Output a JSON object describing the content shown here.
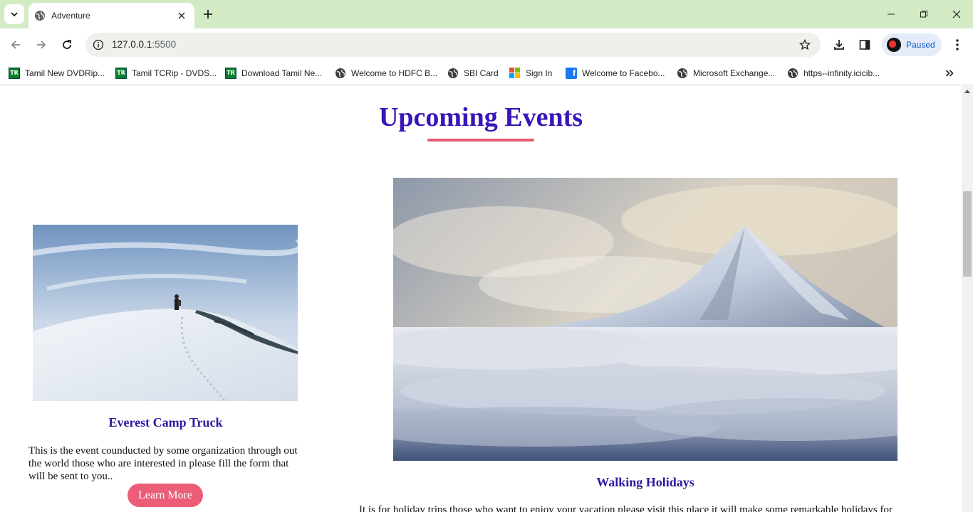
{
  "browser": {
    "tab_title": "Adventure",
    "url_host": "127.0.0.1",
    "url_port": ":5500",
    "profile_label": "Paused"
  },
  "bookmarks": [
    {
      "label": "Tamil New DVDRip...",
      "icon": "tr-icon"
    },
    {
      "label": "Tamil TCRip - DVDS...",
      "icon": "tr-icon"
    },
    {
      "label": "Download Tamil Ne...",
      "icon": "tr-icon"
    },
    {
      "label": "Welcome to HDFC B...",
      "icon": "globe-icon"
    },
    {
      "label": "SBI Card",
      "icon": "globe-icon"
    },
    {
      "label": "Sign In",
      "icon": "microsoft-icon"
    },
    {
      "label": "Welcome to Facebo...",
      "icon": "facebook-icon"
    },
    {
      "label": "Microsoft Exchange...",
      "icon": "globe-icon"
    },
    {
      "label": "https--infinity.icicib...",
      "icon": "globe-icon"
    }
  ],
  "page": {
    "section_title": "Upcoming Events",
    "accent_color": "#e45b72",
    "title_color": "#3a14b8",
    "events": [
      {
        "title": "Everest Camp Truck",
        "description": "This is the event counducted by some organization through out the world those who are interested in please fill the form that will be sent to you..",
        "button_label": "Learn More",
        "image": "mountaineer-on-snow-ridge"
      },
      {
        "title": "Walking Holidays",
        "description": "It is for holiday trips those who want to enjoy your vacation please visit this place it will make some remarkable holidays for",
        "image": "snowy-peak-above-clouds"
      }
    ]
  }
}
